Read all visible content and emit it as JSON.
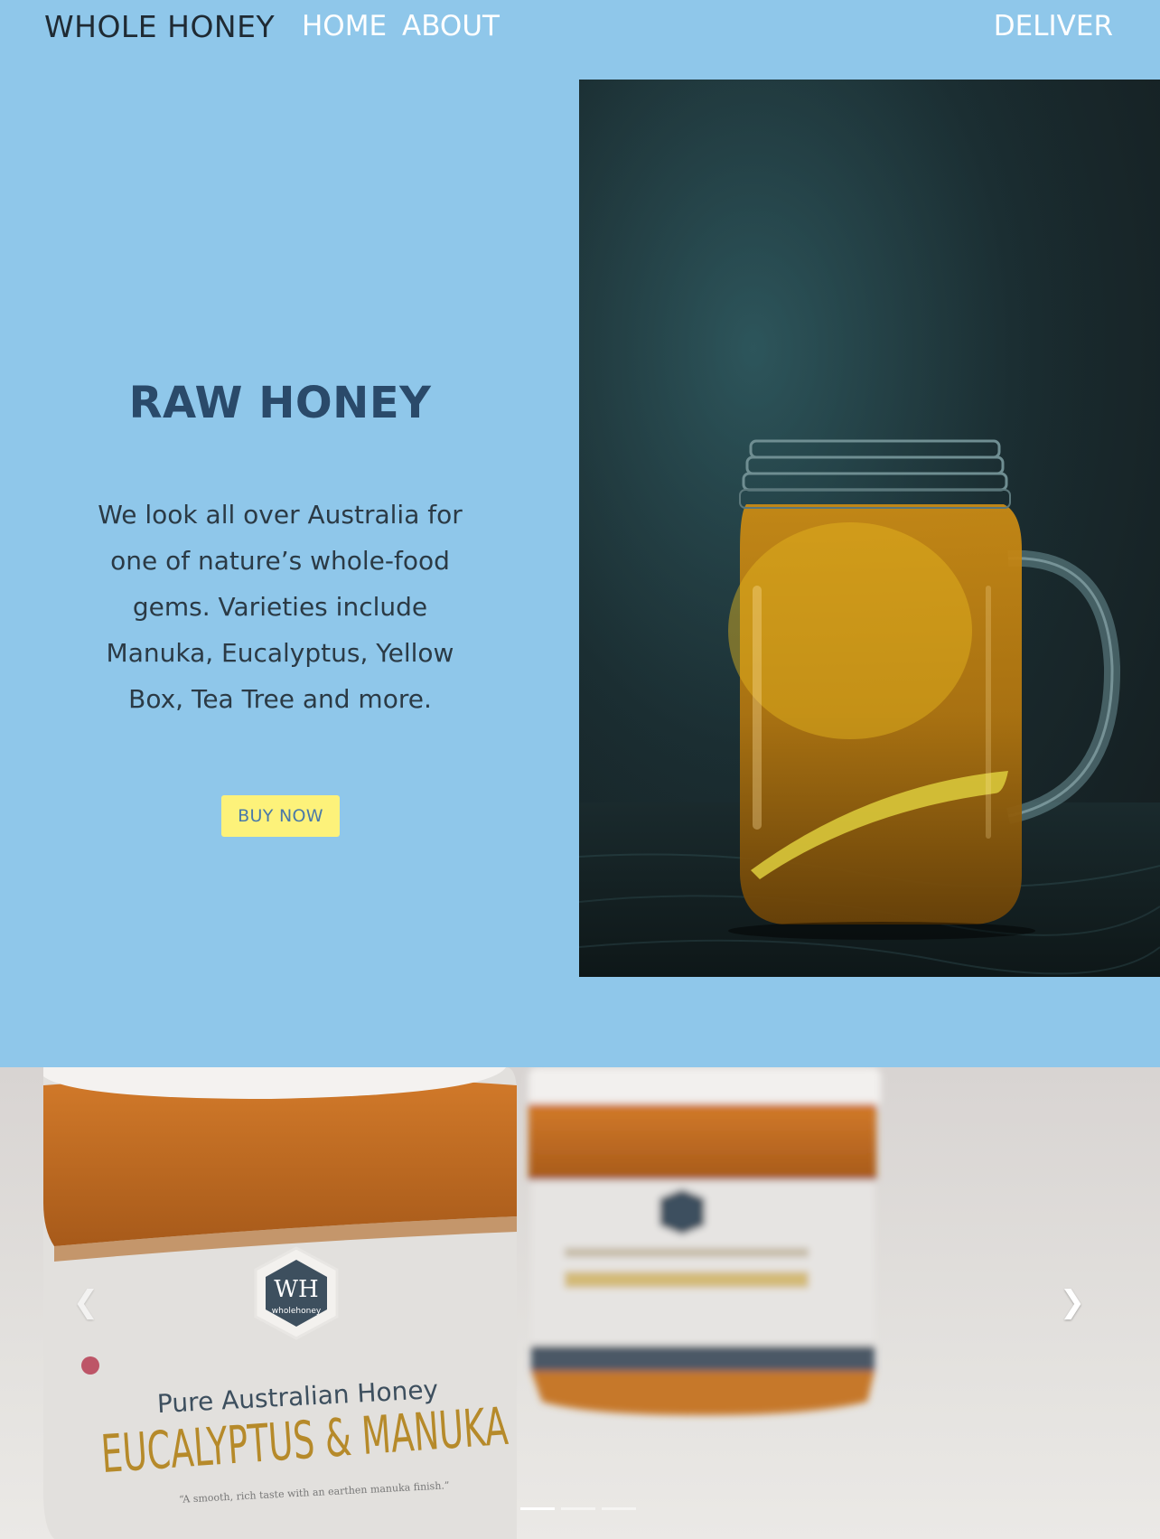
{
  "navbar": {
    "brand": "WHOLE HONEY",
    "links": [
      {
        "label": "HOME"
      },
      {
        "label": "ABOUT"
      }
    ],
    "deliver": "DELIVER"
  },
  "hero": {
    "title": "RAW HONEY",
    "body": "We look all over Australia for one of nature’s whole-food gems. Varieties include Manuka, Eucalyptus, Yellow Box, Tea Tree and more.",
    "cta": "BUY NOW",
    "image_icon": "honey-jar-photo"
  },
  "carousel": {
    "image_icon": "honey-jars-photo",
    "jar_label": {
      "logo": "WH",
      "logo_sub": "wholehoney",
      "heading": "Pure Australian Honey",
      "variety": "EUCALYPTUS & MANUKA",
      "tagline": "“A smooth, rich taste with an earthen manuka finish.”"
    },
    "prev_icon": "chevron-left-icon",
    "next_icon": "chevron-right-icon",
    "slides": 3,
    "active_slide": 1
  },
  "colors": {
    "background": "#8fc7ea",
    "title": "#2a4a6a",
    "button": "#fdf27a",
    "button_text": "#4a79a8"
  }
}
